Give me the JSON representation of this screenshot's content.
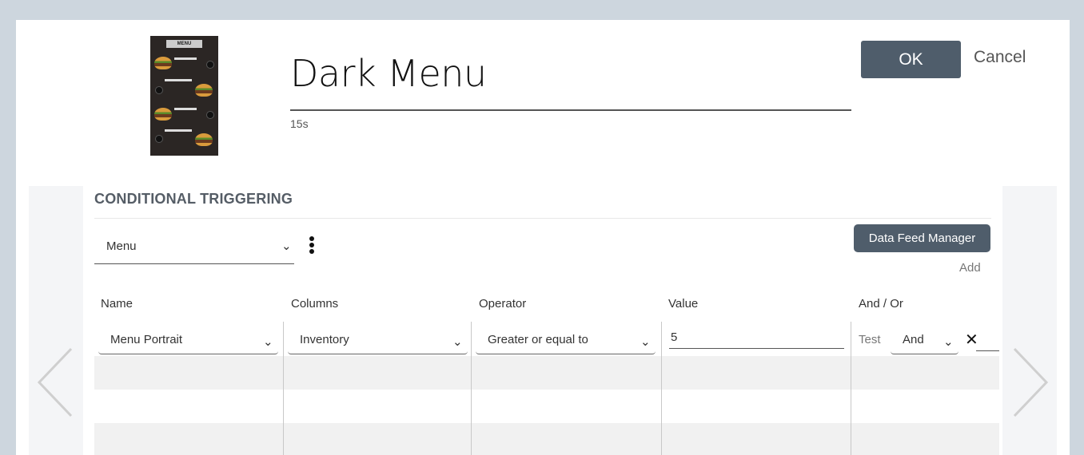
{
  "header": {
    "title": "Dark Menu",
    "duration": "15s",
    "thumbnail_label": "MENU",
    "ok_label": "OK",
    "cancel_label": "Cancel"
  },
  "conditional": {
    "section_title": "CONDITIONAL TRIGGERING",
    "feed_select_value": "Menu",
    "data_feed_manager_label": "Data Feed Manager",
    "add_label": "Add",
    "columns": [
      "Name",
      "Columns",
      "Operator",
      "Value",
      "And / Or"
    ],
    "rows": [
      {
        "name": "Menu Portrait",
        "column": "Inventory",
        "operator": "Greater or equal to",
        "value": "5",
        "test_label": "Test",
        "and_or": "And"
      }
    ]
  },
  "icons": {
    "chevron_down": "⌄",
    "kebab": "more-vert-icon",
    "close": "✕",
    "prev": "chevron-left-icon",
    "next": "chevron-right-icon"
  },
  "colors": {
    "primary_button": "#4f5d6b",
    "backdrop": "#cdd6de"
  }
}
